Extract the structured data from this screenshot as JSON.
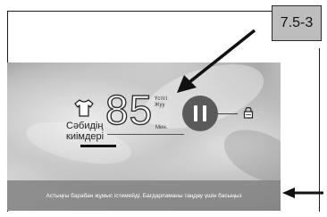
{
  "callout": {
    "label": "7.5-3"
  },
  "program": {
    "name": "Сәбидің киімдері",
    "icon": "baby-shirt-icon"
  },
  "temperature": {
    "value": "85",
    "label_top": "Үстігі Жуу",
    "unit": "Мин."
  },
  "controls": {
    "pause_icon": "pause-icon",
    "lock_icon": "lock-icon"
  },
  "info_bar": {
    "text": "Астыңғы барабан жұмыс істемейді. Бағдарламаны таңдау үшін басыңыз"
  },
  "colors": {
    "pause_button": "#5a5a5a",
    "info_bar": "#828282",
    "callout_box": "#bdbdbd"
  }
}
